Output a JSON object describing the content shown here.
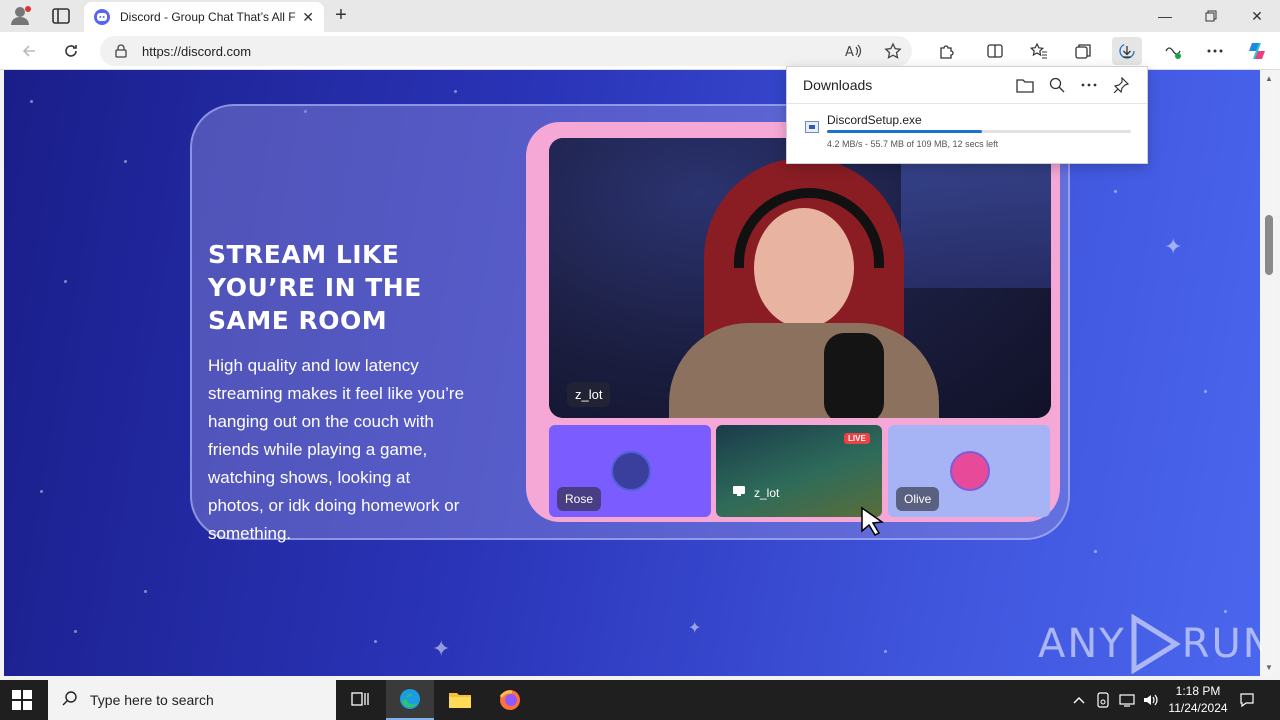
{
  "browser": {
    "tab_title": "Discord - Group Chat That’s All Fun & Games",
    "url": "https://discord.com"
  },
  "downloads": {
    "title": "Downloads",
    "file_name": "DiscordSetup.exe",
    "progress_fraction": 0.51,
    "status": "4.2 MB/s - 55.7 MB of 109 MB, 12 secs left"
  },
  "page": {
    "headline_lines": [
      "STREAM LIKE",
      "YOU’RE IN THE",
      "SAME ROOM"
    ],
    "body_lines": [
      "High quality and low latency",
      "streaming makes it feel like you’re",
      "hanging out on the couch with",
      "friends while playing a game,",
      "watching shows, looking at",
      "photos, or idk doing homework or",
      "something."
    ],
    "main_stream_name": "z_lot",
    "tiles": [
      {
        "name": "Rose",
        "color": "#7a5cff"
      },
      {
        "name": "z_lot",
        "live": "LIVE"
      },
      {
        "name": "Olive",
        "color": "#a6b3f4"
      }
    ]
  },
  "watermark": {
    "left": "ANY",
    "right": "RUN"
  },
  "taskbar": {
    "search_placeholder": "Type here to search",
    "time": "1:18 PM",
    "date": "11/24/2024"
  },
  "colors": {
    "discord_blurple": "#5865f2",
    "stage_pink": "#f5a8d5",
    "download_progress": "#1a73c8"
  }
}
